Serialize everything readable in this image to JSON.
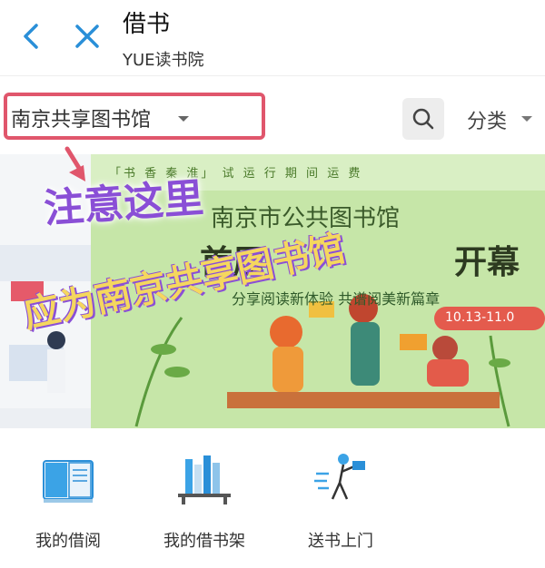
{
  "header": {
    "title": "借书",
    "subtitle": "YUE读书院",
    "back_icon": "chevron-left-icon",
    "close_icon": "close-icon"
  },
  "location": {
    "library": "南京共享图书馆",
    "category_label": "分类",
    "search_icon": "search-icon",
    "highlight_color": "#e0566c"
  },
  "banner": {
    "top_strip": "「书 香 秦 淮」 试 运 行 期 间 运 费",
    "headline": "南京市公共图书馆",
    "headline_big_left": "首届",
    "headline_big_right": "开幕",
    "tagline": "分享阅读新体验 共谱阅美新篇章",
    "date_badge": "10.13-11.0",
    "annotation_line1": "注意这里",
    "annotation_line2": "应为南京共享图书馆"
  },
  "menu": {
    "items": [
      {
        "label": "我的借阅",
        "icon": "book-open-icon"
      },
      {
        "label": "我的借书架",
        "icon": "bookshelf-icon"
      },
      {
        "label": "送书上门",
        "icon": "delivery-person-icon"
      }
    ]
  },
  "colors": {
    "accent_blue": "#2a8fd8",
    "banner_green": "#bfe3a2",
    "annotation_purple": "#8a4fd6"
  }
}
